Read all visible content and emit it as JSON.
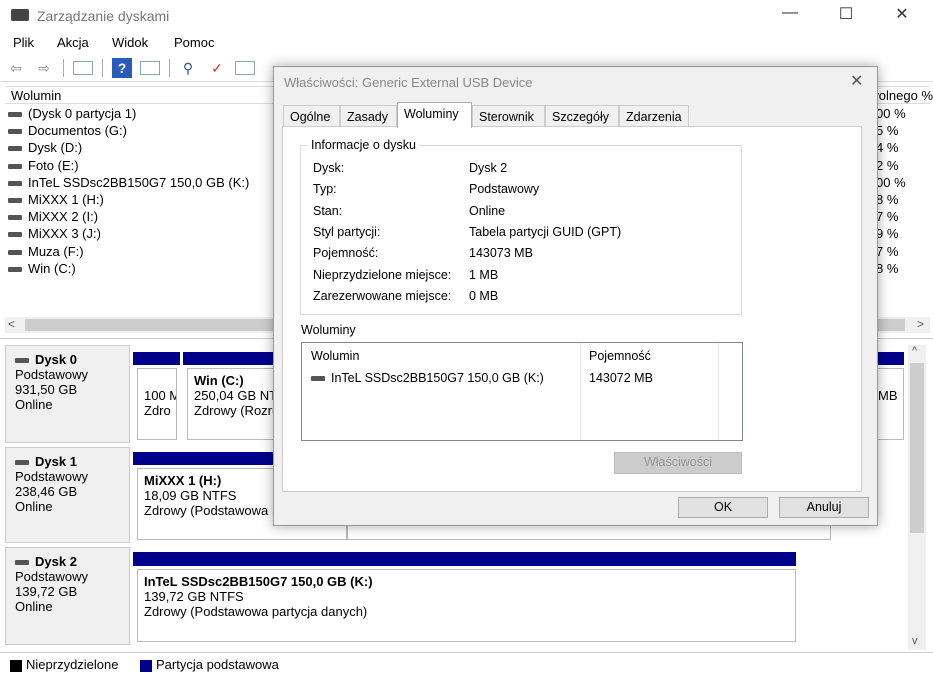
{
  "window": {
    "title": "Zarządzanie dyskami",
    "minimize": "—",
    "maximize": "☐",
    "close": "✕"
  },
  "menu": [
    "Plik",
    "Akcja",
    "Widok",
    "Pomoc"
  ],
  "list": {
    "header": "Wolumin",
    "header_right": "% wolnego",
    "rows": [
      {
        "name": "(Dysk 0 partycja 1)",
        "pct": "00 %"
      },
      {
        "name": "Documentos (G:)",
        "pct": "5 %"
      },
      {
        "name": "Dysk (D:)",
        "pct": "4 %"
      },
      {
        "name": "Foto (E:)",
        "pct": "2 %"
      },
      {
        "name": "InTeL SSDsc2BB150G7 150,0 GB (K:)",
        "pct": "00 %"
      },
      {
        "name": "MiXXX 1 (H:)",
        "pct": "8 %"
      },
      {
        "name": "MiXXX 2 (I:)",
        "pct": "7 %"
      },
      {
        "name": "MiXXX 3 (J:)",
        "pct": "9 %"
      },
      {
        "name": "Muza (F:)",
        "pct": "7 %"
      },
      {
        "name": "Win (C:)",
        "pct": "8 %"
      }
    ]
  },
  "disks": [
    {
      "name": "Dysk 0",
      "type": "Podstawowy",
      "size": "931,50 GB",
      "status": "Online",
      "parts": [
        {
          "l1": "100 M",
          "l2": "Zdro"
        },
        {
          "title": "Win  (C:)",
          "l1": "250,04 GB NTFS",
          "l2": "Zdrowy (Rozruch"
        }
      ],
      "right": "MB"
    },
    {
      "name": "Dysk 1",
      "type": "Podstawowy",
      "size": "238,46 GB",
      "status": "Online",
      "parts": [
        {
          "title": "MiXXX 1  (H:)",
          "l1": "18,09 GB NTFS",
          "l2": "Zdrowy (Podstawowa"
        }
      ]
    },
    {
      "name": "Dysk 2",
      "type": "Podstawowy",
      "size": "139,72 GB",
      "status": "Online",
      "parts": [
        {
          "title": "InTeL SSDsc2BB150G7 150,0 GB  (K:)",
          "l1": "139,72 GB NTFS",
          "l2": "Zdrowy (Podstawowa partycja danych)"
        }
      ]
    }
  ],
  "legend": [
    {
      "label": "Nieprzydzielone",
      "color": "#000000"
    },
    {
      "label": "Partycja podstawowa",
      "color": "#00008b"
    }
  ],
  "dialog": {
    "title": "Właściwości: Generic External USB Device",
    "close": "✕",
    "tabs": [
      "Ogólne",
      "Zasady",
      "Woluminy",
      "Sterownik",
      "Szczegóły",
      "Zdarzenia"
    ],
    "active_tab": "Woluminy",
    "info_group": "Informacje o dysku",
    "info": [
      {
        "label": "Dysk:",
        "value": "Dysk 2"
      },
      {
        "label": "Typ:",
        "value": "Podstawowy"
      },
      {
        "label": "Stan:",
        "value": "Online"
      },
      {
        "label": "Styl partycji:",
        "value": "Tabela partycji GUID (GPT)"
      },
      {
        "label": "Pojemność:",
        "value": "143073 MB"
      },
      {
        "label": "Nieprzydzielone miejsce:",
        "value": "1 MB"
      },
      {
        "label": "Zarezerwowane miejsce:",
        "value": "0 MB"
      }
    ],
    "volumes_label": "Woluminy",
    "volumes_headers": [
      "Wolumin",
      "Pojemność"
    ],
    "volumes": [
      {
        "name": "InTeL SSDsc2BB150G7 150,0 GB (K:)",
        "size": "143072 MB"
      }
    ],
    "properties_button": "Właściwości",
    "ok": "OK",
    "cancel": "Anuluj"
  }
}
